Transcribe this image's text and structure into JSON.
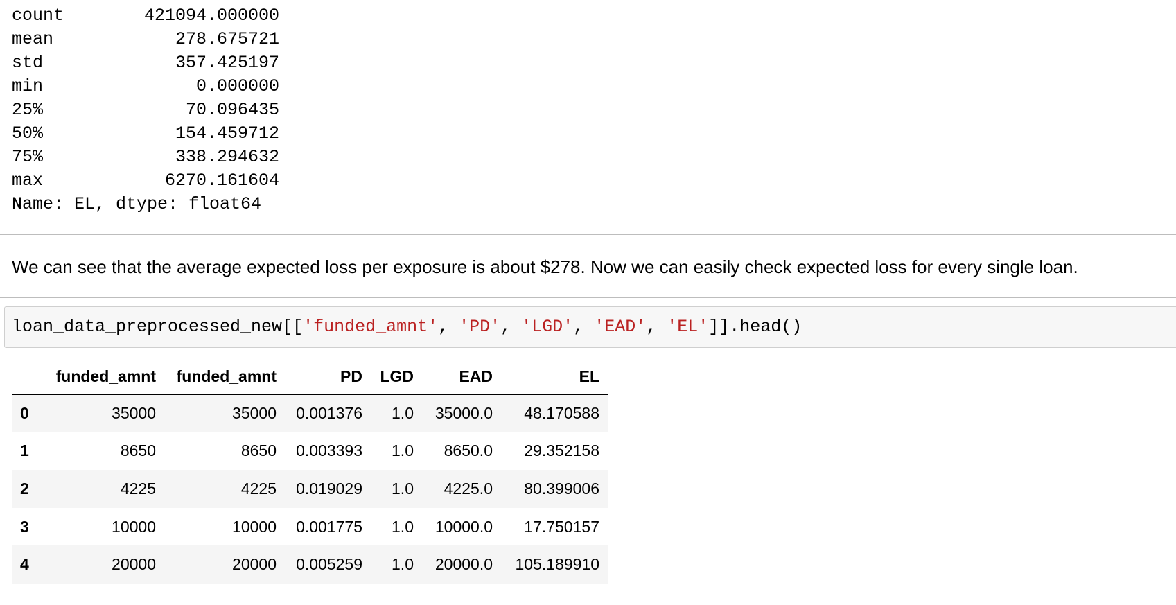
{
  "describe_output": {
    "rows": [
      {
        "key": "count",
        "value": "421094.000000"
      },
      {
        "key": "mean",
        "value": "278.675721"
      },
      {
        "key": "std",
        "value": "357.425197"
      },
      {
        "key": "min",
        "value": "0.000000"
      },
      {
        "key": "25%",
        "value": "70.096435"
      },
      {
        "key": "50%",
        "value": "154.459712"
      },
      {
        "key": "75%",
        "value": "338.294632"
      },
      {
        "key": "max",
        "value": "6270.161604"
      }
    ],
    "footer": "Name: EL, dtype: float64"
  },
  "markdown": {
    "text": "We can see that the average expected loss per exposure is about $278. Now we can easily check expected loss for every single loan."
  },
  "code_cell": {
    "prefix": "loan_data_preprocessed_new[[",
    "args": [
      "'funded_amnt'",
      "'PD'",
      "'LGD'",
      "'EAD'",
      "'EL'"
    ],
    "separator": ", ",
    "suffix": "]].head()"
  },
  "dataframe": {
    "columns": [
      "funded_amnt",
      "funded_amnt",
      "PD",
      "LGD",
      "EAD",
      "EL"
    ],
    "rows": [
      {
        "index": "0",
        "cells": [
          "35000",
          "35000",
          "0.001376",
          "1.0",
          "35000.0",
          "48.170588"
        ]
      },
      {
        "index": "1",
        "cells": [
          "8650",
          "8650",
          "0.003393",
          "1.0",
          "8650.0",
          "29.352158"
        ]
      },
      {
        "index": "2",
        "cells": [
          "4225",
          "4225",
          "0.019029",
          "1.0",
          "4225.0",
          "80.399006"
        ]
      },
      {
        "index": "3",
        "cells": [
          "10000",
          "10000",
          "0.001775",
          "1.0",
          "10000.0",
          "17.750157"
        ]
      },
      {
        "index": "4",
        "cells": [
          "20000",
          "20000",
          "0.005259",
          "1.0",
          "20000.0",
          "105.189910"
        ]
      }
    ]
  },
  "colors": {
    "string_literal": "#ba2121",
    "code_background": "#f7f7f7",
    "striped_row": "#f5f5f5"
  }
}
